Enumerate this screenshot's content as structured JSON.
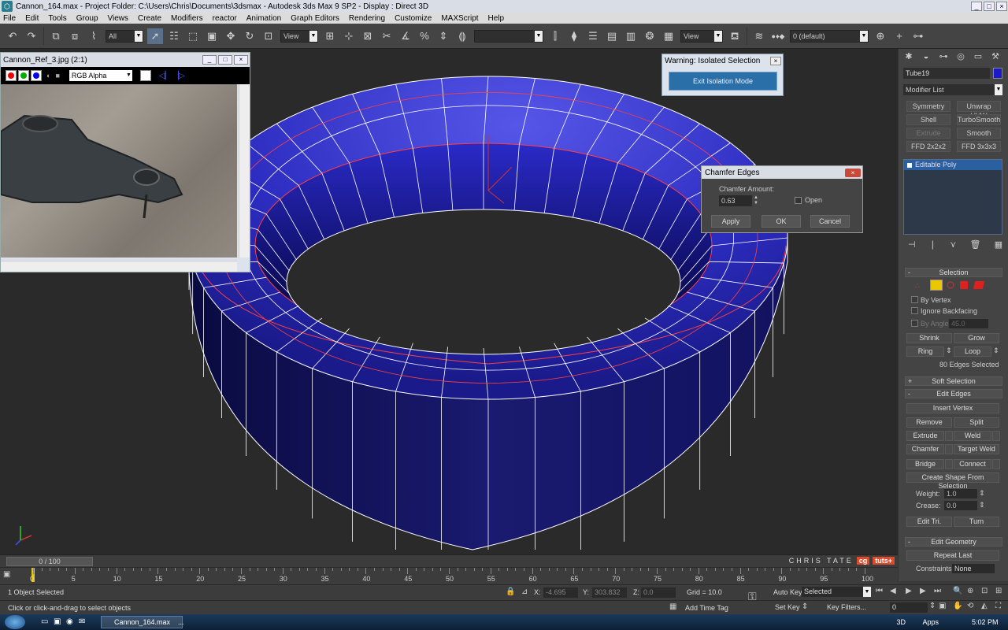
{
  "window": {
    "title": "Cannon_164.max    - Project Folder: C:\\Users\\Chris\\Documents\\3dsmax    - Autodesk 3ds Max 9 SP2    - Display : Direct 3D"
  },
  "menu": [
    "File",
    "Edit",
    "Tools",
    "Group",
    "Views",
    "Create",
    "Modifiers",
    "reactor",
    "Animation",
    "Graph Editors",
    "Rendering",
    "Customize",
    "MAXScript",
    "Help"
  ],
  "toolbar": {
    "filter": "All",
    "coord_system": "View",
    "coord_system2": "View",
    "layer": "0 (default)"
  },
  "ref_window": {
    "title": "Cannon_Ref_3.jpg (2:1)",
    "channel": "RGB Alpha"
  },
  "warning_dialog": {
    "title": "Warning: Isolated Selection",
    "button": "Exit Isolation Mode"
  },
  "chamfer_dialog": {
    "title": "Chamfer Edges",
    "amount_label": "Chamfer Amount:",
    "amount_value": "0.63",
    "open_label": "Open",
    "apply": "Apply",
    "ok": "OK",
    "cancel": "Cancel"
  },
  "command_panel": {
    "object_name": "Tube19",
    "object_color": "#1a1acc",
    "modifier_list": "Modifier List",
    "modifier_buttons": [
      [
        "Symmetry",
        "Unwrap UVW"
      ],
      [
        "Shell",
        "TurboSmooth"
      ],
      [
        "Extrude",
        "Smooth"
      ],
      [
        "FFD 2x2x2",
        "FFD 3x3x3"
      ]
    ],
    "stack_item": "Editable Poly",
    "selection": {
      "title": "Selection",
      "by_vertex": "By Vertex",
      "ignore_backfacing": "Ignore Backfacing",
      "by_angle": "By Angle:",
      "angle_value": "45.0",
      "shrink": "Shrink",
      "grow": "Grow",
      "ring": "Ring",
      "loop": "Loop",
      "status": "80 Edges Selected"
    },
    "soft_selection": "Soft Selection",
    "edit_edges": {
      "title": "Edit Edges",
      "insert_vertex": "Insert Vertex",
      "remove": "Remove",
      "split": "Split",
      "extrude": "Extrude",
      "weld": "Weld",
      "chamfer": "Chamfer",
      "target_weld": "Target Weld",
      "bridge": "Bridge",
      "connect": "Connect",
      "create_shape": "Create Shape From Selection",
      "weight_label": "Weight:",
      "weight_value": "1.0",
      "crease_label": "Crease:",
      "crease_value": "0.0",
      "edit_tri": "Edit Tri.",
      "turn": "Turn"
    },
    "edit_geometry": {
      "title": "Edit Geometry",
      "repeat_last": "Repeat Last",
      "constraints_label": "Constraints:",
      "constraints_value": "None"
    }
  },
  "timeline": {
    "frame": "0 / 100",
    "ticks": [
      "0",
      "5",
      "10",
      "15",
      "20",
      "25",
      "30",
      "35",
      "40",
      "45",
      "50",
      "55",
      "60",
      "65",
      "70",
      "75",
      "80",
      "85",
      "90",
      "95",
      "100"
    ]
  },
  "branding": {
    "author": "CHRIS TATE",
    "logo_cg": "cg",
    "logo_tuts": "tuts+"
  },
  "status": {
    "selected": "1 Object Selected",
    "prompt": "Click or click-and-drag to select objects",
    "x_label": "X:",
    "x_value": "-4.695",
    "y_label": "Y:",
    "y_value": "303.832",
    "z_label": "Z:",
    "z_value": "0.0",
    "grid": "Grid = 10.0",
    "add_time_tag": "Add Time Tag",
    "auto_key": "Auto Key",
    "set_key": "Set Key",
    "key_mode": "Selected",
    "key_filters": "Key Filters...",
    "frame_field": "0"
  },
  "taskbar": {
    "task": "Cannon_164.max",
    "more": "...",
    "lang": "3D",
    "apps": "Apps",
    "time": "5:02 PM"
  }
}
